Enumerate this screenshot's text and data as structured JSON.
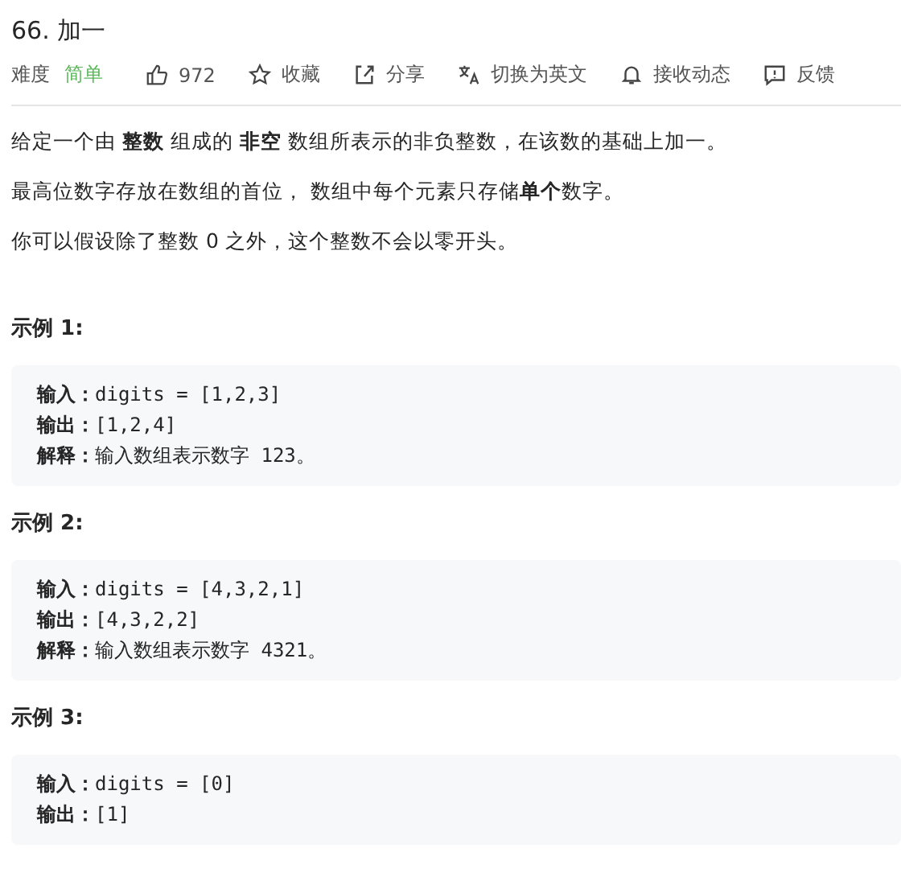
{
  "title": "66. 加一",
  "meta": {
    "difficulty_label": "难度",
    "difficulty": "简单",
    "actions": [
      {
        "kind": "like",
        "label": "972"
      },
      {
        "kind": "star",
        "label": "收藏"
      },
      {
        "kind": "share",
        "label": "分享"
      },
      {
        "kind": "translate",
        "label": "切换为英文"
      },
      {
        "kind": "bell",
        "label": "接收动态"
      },
      {
        "kind": "feedback",
        "label": "反馈"
      }
    ]
  },
  "description": [
    "给定一个由 **整数** 组成的 **非空** 数组所表示的非负整数，在该数的基础上加一。",
    "最高位数字存放在数组的首位， 数组中每个元素只存储**单个**数字。",
    "你可以假设除了整数 0 之外，这个整数不会以零开头。"
  ],
  "examples": [
    {
      "heading": "示例 1:",
      "lines": [
        {
          "label": "输入：",
          "value": "digits = [1,2,3]"
        },
        {
          "label": "输出：",
          "value": "[1,2,4]"
        },
        {
          "label": "解释：",
          "value": "输入数组表示数字 123。"
        }
      ]
    },
    {
      "heading": "示例 2:",
      "lines": [
        {
          "label": "输入：",
          "value": "digits = [4,3,2,1]"
        },
        {
          "label": "输出：",
          "value": "[4,3,2,2]"
        },
        {
          "label": "解释：",
          "value": "输入数组表示数字 4321。"
        }
      ]
    },
    {
      "heading": "示例 3:",
      "lines": [
        {
          "label": "输入：",
          "value": "digits = [0]"
        },
        {
          "label": "输出：",
          "value": "[1]"
        }
      ]
    }
  ]
}
